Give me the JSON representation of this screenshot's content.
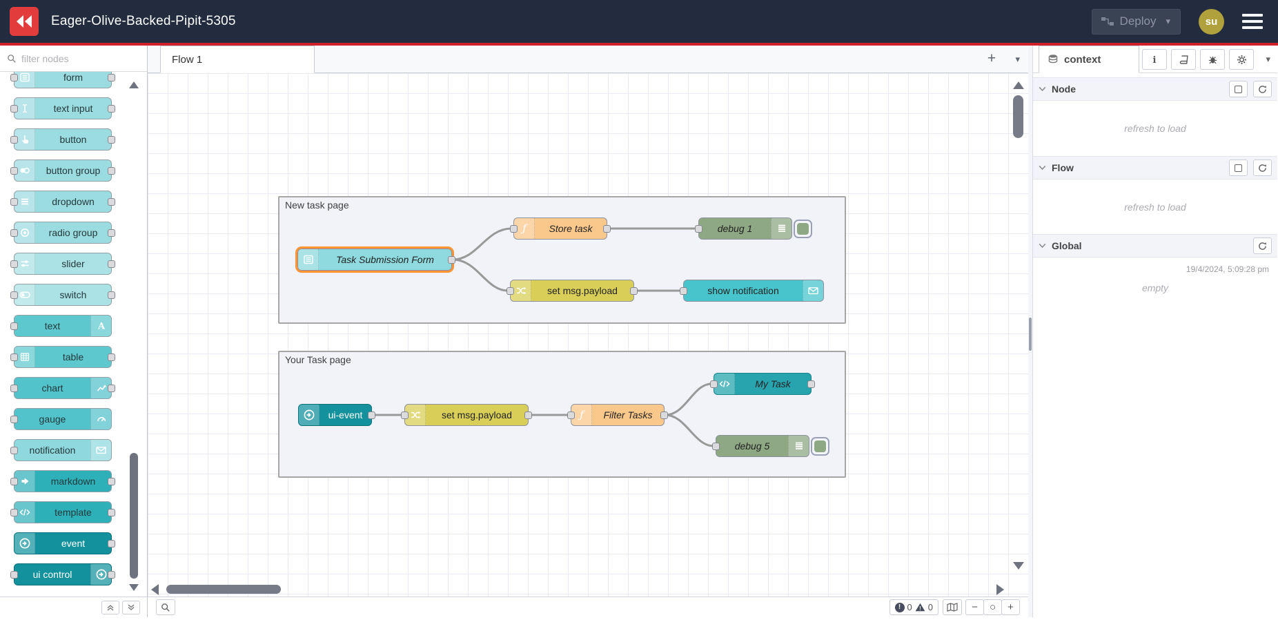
{
  "colors": {
    "header_bg": "#222c3e",
    "accent_red": "#ce2129",
    "logo_red": "#e23c3c",
    "teal_light": "#9bdce1",
    "teal_lighter": "#abe2e6",
    "teal_mid": "#5ec8cf",
    "teal_chart": "#52c3cb",
    "teal_notification": "#8fd9de",
    "teal_dark": "#2eb0b9",
    "teal_darkest": "#13929e",
    "node_function": "#fbc88c",
    "node_change": "#d9cf58",
    "node_debug": "#8ea884",
    "node_template": "#27a4ae",
    "selected_outline": "#ff9233",
    "wire": "#999999",
    "avatar_bg": "#b1a13c"
  },
  "header": {
    "title": "Eager-Olive-Backed-Pipit-5305",
    "deploy_label": "Deploy",
    "user_initials": "su"
  },
  "palette": {
    "filter_placeholder": "filter nodes",
    "items": [
      {
        "label": "form",
        "icon": "form-icon"
      },
      {
        "label": "text input",
        "icon": "text-input-icon"
      },
      {
        "label": "button",
        "icon": "button-icon"
      },
      {
        "label": "button group",
        "icon": "button-group-icon"
      },
      {
        "label": "dropdown",
        "icon": "dropdown-icon"
      },
      {
        "label": "radio group",
        "icon": "radio-group-icon"
      },
      {
        "label": "slider",
        "icon": "slider-icon"
      },
      {
        "label": "switch",
        "icon": "switch-icon"
      },
      {
        "label": "text",
        "icon": "text-icon"
      },
      {
        "label": "table",
        "icon": "table-icon"
      },
      {
        "label": "chart",
        "icon": "chart-icon"
      },
      {
        "label": "gauge",
        "icon": "gauge-icon"
      },
      {
        "label": "notification",
        "icon": "envelope-icon"
      },
      {
        "label": "markdown",
        "icon": "markdown-icon"
      },
      {
        "label": "template",
        "icon": "code-icon"
      },
      {
        "label": "event",
        "icon": "circle-arrow-icon"
      },
      {
        "label": "ui control",
        "icon": "circle-arrow-icon"
      }
    ]
  },
  "workspace": {
    "tab_label": "Flow 1",
    "groups": [
      {
        "label": "New task page"
      },
      {
        "label": "Your Task page"
      }
    ],
    "nodes": [
      {
        "label": "Task Submission Form",
        "type": "ui-form",
        "selected": true
      },
      {
        "label": "Store task",
        "type": "function"
      },
      {
        "label": "debug 1",
        "type": "debug"
      },
      {
        "label": "set msg.payload",
        "type": "change"
      },
      {
        "label": "show notification",
        "type": "ui-notification"
      },
      {
        "label": "ui-event",
        "type": "ui-event"
      },
      {
        "label": "set msg.payload",
        "type": "change"
      },
      {
        "label": "Filter Tasks",
        "type": "function"
      },
      {
        "label": "My Task",
        "type": "ui-template"
      },
      {
        "label": "debug 5",
        "type": "debug"
      }
    ]
  },
  "sidebar": {
    "tab_label": "context",
    "sections": [
      {
        "label": "Node",
        "body": "refresh to load"
      },
      {
        "label": "Flow",
        "body": "refresh to load"
      },
      {
        "label": "Global",
        "timestamp": "19/4/2024, 5:09:28 pm",
        "body": "empty"
      }
    ]
  },
  "footer": {
    "error_count": "0",
    "warning_count": "0"
  },
  "icons": {
    "plus": "+",
    "caret_down": "▾",
    "zoom_out": "−",
    "zoom_reset": "○",
    "zoom_in": "+",
    "info": "i"
  }
}
